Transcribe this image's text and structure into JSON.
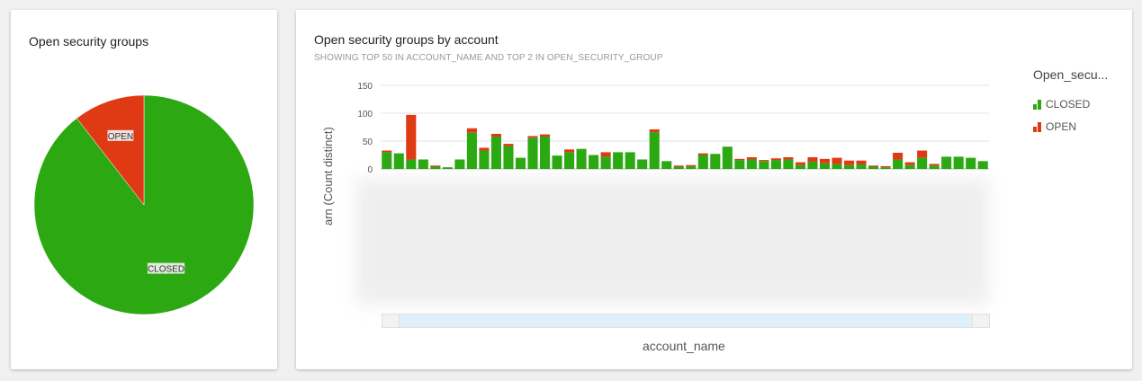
{
  "left_panel": {
    "title": "Open security groups"
  },
  "right_panel": {
    "title": "Open security groups by account",
    "subtitle": "SHOWING TOP 50 IN ACCOUNT_NAME AND TOP 2 IN OPEN_SECURITY_GROUP"
  },
  "legend": {
    "title": "Open_secu...",
    "items": [
      {
        "label": "CLOSED",
        "color": "#2ca912"
      },
      {
        "label": "OPEN",
        "color": "#e03a14"
      }
    ]
  },
  "colors": {
    "closed": "#2ca912",
    "open": "#e03a14"
  },
  "chart_data": [
    {
      "type": "pie",
      "title": "Open security groups",
      "slices": [
        {
          "label": "CLOSED",
          "value": 89.5,
          "color": "#2ca912"
        },
        {
          "label": "OPEN",
          "value": 10.5,
          "color": "#e03a14"
        }
      ]
    },
    {
      "type": "bar",
      "stacked": true,
      "title": "Open security groups by account",
      "xlabel": "account_name",
      "ylabel": "arn (Count distinct)",
      "ylim": [
        0,
        150
      ],
      "yticks": [
        0,
        50,
        100,
        150
      ],
      "grid": true,
      "legend_position": "right",
      "category_labels_visible": false,
      "series": [
        {
          "name": "CLOSED",
          "values": [
            30,
            28,
            17,
            17,
            4,
            3,
            17,
            65,
            33,
            58,
            41,
            20,
            56,
            58,
            24,
            30,
            36,
            25,
            22,
            30,
            30,
            17,
            66,
            14,
            4,
            5,
            25,
            27,
            40,
            16,
            17,
            14,
            16,
            17,
            7,
            13,
            10,
            9,
            7,
            8,
            4,
            3,
            17,
            7,
            20,
            6,
            22,
            22,
            20,
            14
          ]
        },
        {
          "name": "OPEN",
          "values": [
            3,
            0,
            80,
            0,
            2,
            0,
            0,
            8,
            5,
            5,
            4,
            0,
            3,
            4,
            0,
            5,
            0,
            0,
            8,
            0,
            0,
            0,
            5,
            0,
            2,
            2,
            3,
            0,
            0,
            2,
            4,
            2,
            3,
            4,
            5,
            8,
            8,
            11,
            8,
            7,
            2,
            2,
            12,
            5,
            13,
            3,
            0,
            0,
            0,
            0
          ]
        }
      ]
    }
  ]
}
